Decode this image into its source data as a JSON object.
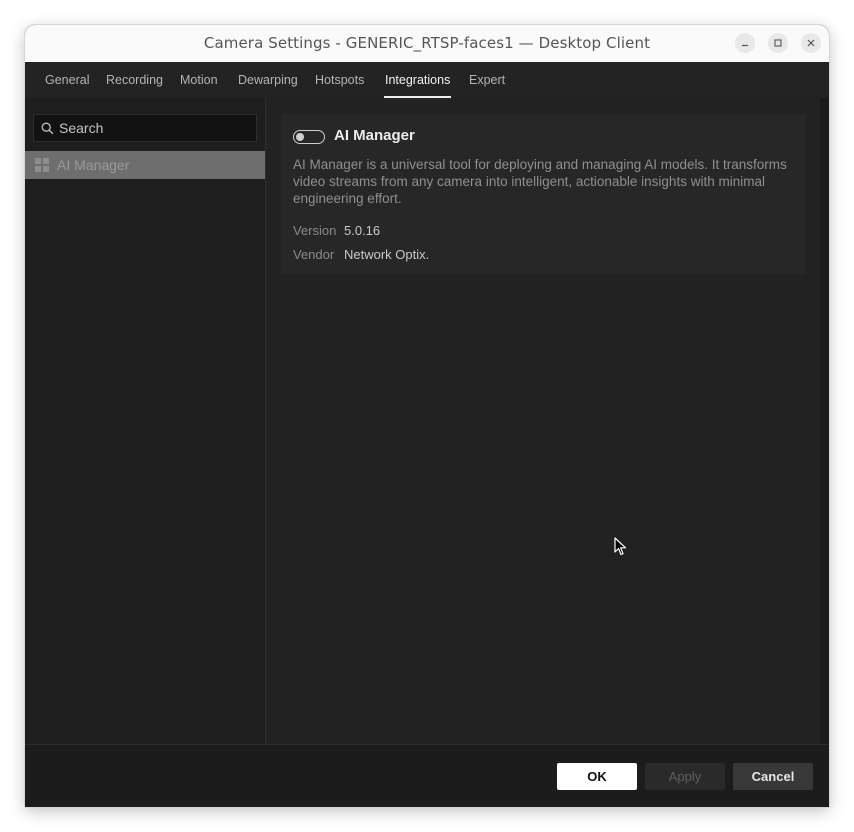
{
  "window": {
    "title": "Camera Settings - GENERIC_RTSP-faces1 — Desktop Client"
  },
  "tabs": [
    {
      "label": "General"
    },
    {
      "label": "Recording"
    },
    {
      "label": "Motion"
    },
    {
      "label": "Dewarping"
    },
    {
      "label": "Hotspots"
    },
    {
      "label": "Integrations",
      "active": true
    },
    {
      "label": "Expert"
    }
  ],
  "sidebar": {
    "search_placeholder": "Search",
    "search_value": "",
    "items": [
      {
        "label": "AI Manager",
        "selected": true
      }
    ]
  },
  "plugin": {
    "name": "AI Manager",
    "enabled": false,
    "description": "AI Manager is a universal tool for deploying and managing AI models. It transforms video streams from any camera into intelligent, actionable insights with minimal engineering effort.",
    "version_label": "Version",
    "version": "5.0.16",
    "vendor_label": "Vendor",
    "vendor": "Network Optix."
  },
  "footer": {
    "ok_label": "OK",
    "apply_label": "Apply",
    "cancel_label": "Cancel"
  },
  "colors": {
    "background": "#1e1e1e",
    "panel": "#222222",
    "card": "#272727",
    "selected_item": "#6e6e6e",
    "primary_button": "#ffffff"
  }
}
